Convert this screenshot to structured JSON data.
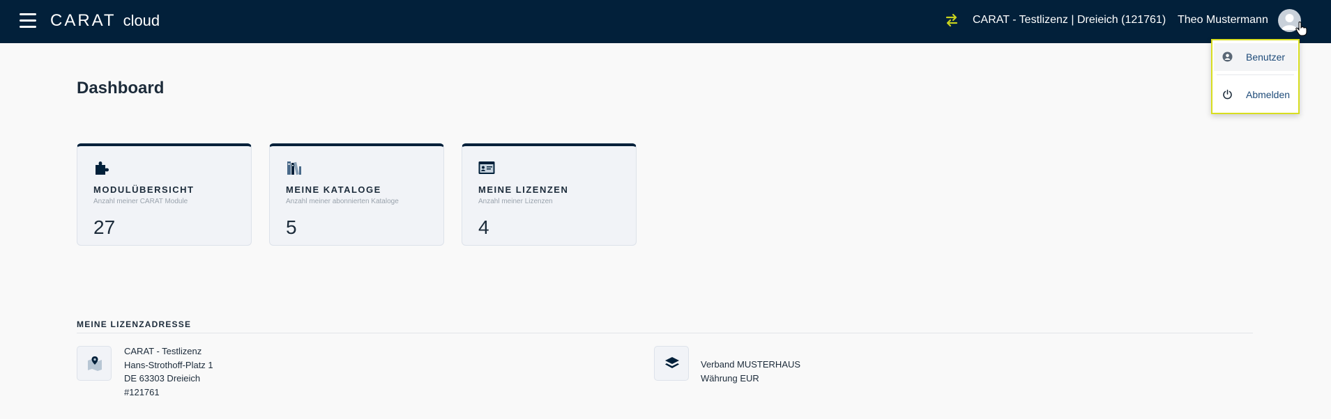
{
  "header": {
    "logo_text": "CARAT",
    "logo_suffix": "cloud",
    "license_name": "CARAT - Testlizenz | Dreieich (121761)",
    "user_name": "Theo Mustermann"
  },
  "user_menu": {
    "items": [
      {
        "label": "Benutzer",
        "icon": "user-circle-icon"
      },
      {
        "label": "Abmelden",
        "icon": "power-icon"
      }
    ]
  },
  "page": {
    "title": "Dashboard"
  },
  "cards": [
    {
      "icon": "puzzle-icon",
      "title": "MODULÜBERSICHT",
      "subtitle": "Anzahl meiner CARAT Module",
      "value": "27"
    },
    {
      "icon": "books-icon",
      "title": "MEINE KATALOGE",
      "subtitle": "Anzahl meiner abonnierten Kataloge",
      "value": "5"
    },
    {
      "icon": "id-card-icon",
      "title": "MEINE LIZENZEN",
      "subtitle": "Anzahl meiner Lizenzen",
      "value": "4"
    }
  ],
  "license_address": {
    "section_title": "MEINE LIZENZADRESSE",
    "address": {
      "icon": "map-pin-icon",
      "lines": [
        "CARAT - Testlizenz",
        "Hans-Strothoff-Platz 1",
        "DE 63303 Dreieich",
        "#121761"
      ]
    },
    "association": {
      "icon": "layers-icon",
      "lines": [
        "Verband MUSTERHAUS",
        "Währung EUR"
      ]
    }
  },
  "colors": {
    "header_bg": "#02203a",
    "accent": "#c8d21e",
    "link": "#1e4b79",
    "card_bg": "#f1f3f7"
  }
}
